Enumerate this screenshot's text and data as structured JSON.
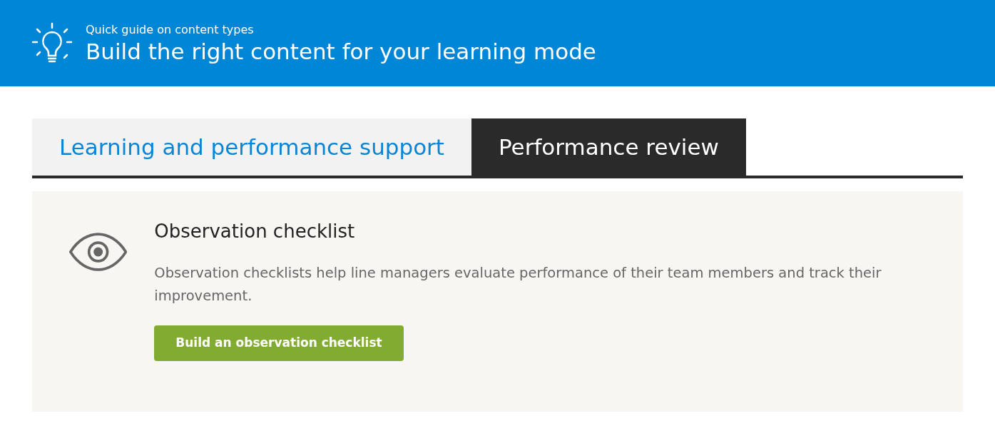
{
  "header": {
    "subtitle": "Quick guide on content types",
    "title": "Build the right content for your learning mode"
  },
  "tabs": [
    {
      "label": "Learning and performance support",
      "selected": false
    },
    {
      "label": "Performance review",
      "selected": true
    }
  ],
  "panel": {
    "title": "Observation checklist",
    "description": "Observation checklists help line managers evaluate performance of their team members and track their improvement.",
    "button": "Build an observation checklist"
  }
}
